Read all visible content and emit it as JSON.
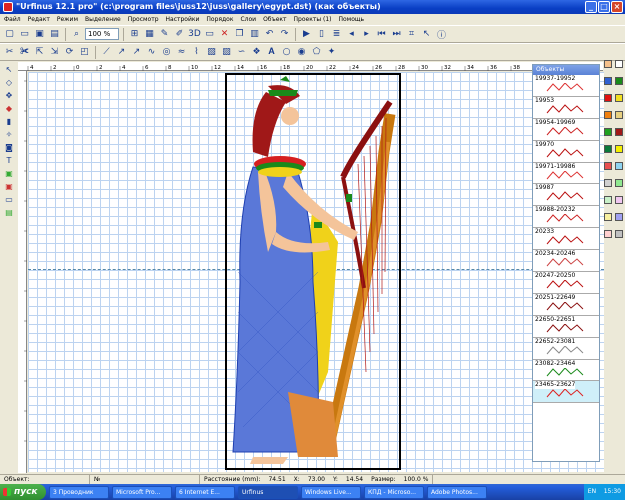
{
  "window": {
    "title": "\"Urfinus 12.1 pro\" (c:\\program files\\juss12\\juss\\gallery\\egypt.dst) (как объекты)"
  },
  "menu": [
    "Файл",
    "Редакт",
    "Режим",
    "Выделение",
    "Просмотр",
    "Настройки",
    "Порядок",
    "Слои",
    "Объект",
    "Проекты (1)",
    "Помощь"
  ],
  "toolbar": {
    "zoom_value": "100 %",
    "btn_3d": "3D"
  },
  "rulers": {
    "h_labels": [
      "4",
      "2",
      "0",
      "2",
      "4",
      "6",
      "8",
      "10",
      "12",
      "14",
      "16",
      "18",
      "20",
      "22",
      "24",
      "26",
      "28",
      "30",
      "32",
      "34",
      "36",
      "38",
      "40",
      "42",
      "44"
    ]
  },
  "objects_panel": {
    "header": "Объекты",
    "items": [
      {
        "label": "19937-19952",
        "color": "#d33"
      },
      {
        "label": "19953",
        "color": "#b11"
      },
      {
        "label": "19954-19969",
        "color": "#c22"
      },
      {
        "label": "19970",
        "color": "#b11"
      },
      {
        "label": "19971-19986",
        "color": "#d33"
      },
      {
        "label": "19987",
        "color": "#b11"
      },
      {
        "label": "19988-20232",
        "color": "#c22"
      },
      {
        "label": "20233",
        "color": "#b11"
      },
      {
        "label": "20234-20246",
        "color": "#c44"
      },
      {
        "label": "20247-20250",
        "color": "#b11"
      },
      {
        "label": "20251-22649",
        "color": "#8b1010"
      },
      {
        "label": "22650-22651",
        "color": "#8b1010"
      },
      {
        "label": "22652-23081",
        "color": "#888"
      },
      {
        "label": "23082-23464",
        "color": "#1a8a1a"
      },
      {
        "label": "23465-23627",
        "color": "#d22"
      }
    ]
  },
  "status": {
    "object": "Объект:",
    "number": "№",
    "distance_label": "Расстояние (mm):",
    "distance": "74.51",
    "x_label": "X:",
    "x": "73.00",
    "y_label": "Y:",
    "y": "14.54",
    "size_label": "Размер:",
    "size": "100.0 %"
  },
  "taskbar": {
    "start": "пуск",
    "tasks": [
      "3 Проводник",
      "Microsoft Pro...",
      "6 Internet E...",
      "Urfinus",
      "Windows Live...",
      "КПД - Microso...",
      "Adobe Photos..."
    ],
    "lang": "EN",
    "clock": "15:30"
  },
  "palette_colors": [
    "#f5c08a",
    "#fff",
    "#3060d0",
    "#1a8a1a",
    "#e01010",
    "#f2e020",
    "#f08010",
    "#e8d080",
    "#20a020",
    "#a01818",
    "#0a7a3a",
    "#f4f000",
    "#e85050",
    "#8fd4f0",
    "#d0d0d0",
    "#90e890",
    "#c8f0c8",
    "#f0c8f0",
    "#f8f0a0",
    "#a0a0f0",
    "#ffd0d0",
    "#c0c0c0"
  ]
}
